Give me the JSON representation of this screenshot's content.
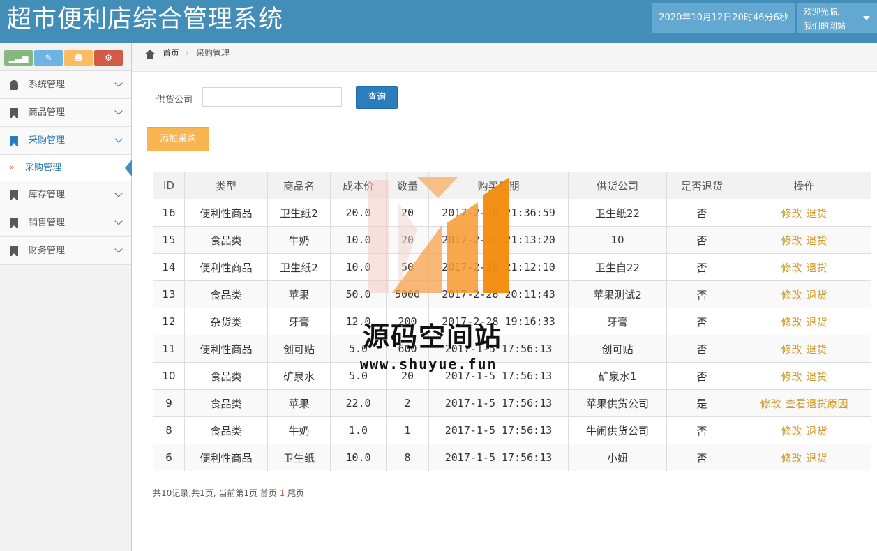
{
  "header": {
    "title": "超市便利店综合管理系统",
    "datetime": "2020年10月12日20时46分6秒",
    "welcome_line1": "欢迎光临,",
    "welcome_line2": "我们的网站"
  },
  "shortcuts": [
    {
      "icon": "signal-icon",
      "glyph": "▁▃▅",
      "color": "#87b87f"
    },
    {
      "icon": "pencil-icon",
      "glyph": "✎",
      "color": "#6fb3e0"
    },
    {
      "icon": "users-icon",
      "glyph": "☻",
      "color": "#fbbc64"
    },
    {
      "icon": "cogs-icon",
      "glyph": "⚙",
      "color": "#d15b47"
    }
  ],
  "sidebar": {
    "items": [
      {
        "label": "系统管理"
      },
      {
        "label": "商品管理"
      },
      {
        "label": "采购管理"
      },
      {
        "label": "库存管理"
      },
      {
        "label": "销售管理"
      },
      {
        "label": "财务管理"
      }
    ],
    "submenu": {
      "arrow": "»",
      "label": "采购管理"
    }
  },
  "breadcrumb": {
    "home": "首页",
    "sep": "›",
    "current": "采购管理"
  },
  "search": {
    "label": "供货公司",
    "value": "",
    "button": "查询"
  },
  "toolbar": {
    "add_label": "添加采购"
  },
  "table": {
    "headers": [
      "ID",
      "类型",
      "商品名",
      "成本价",
      "数量",
      "购买日期",
      "供货公司",
      "是否退货",
      "操作"
    ],
    "rows": [
      {
        "id": "16",
        "type": "便利性商品",
        "name": "卫生纸2",
        "cost": "20.0",
        "qty": "20",
        "date": "2017-2-28 21:36:59",
        "supplier": "卫生纸22",
        "returned": "否",
        "op1": "修改",
        "op2": "退货"
      },
      {
        "id": "15",
        "type": "食品类",
        "name": "牛奶",
        "cost": "10.0",
        "qty": "20",
        "date": "2017-2-28 21:13:20",
        "supplier": "10",
        "returned": "否",
        "op1": "修改",
        "op2": "退货"
      },
      {
        "id": "14",
        "type": "便利性商品",
        "name": "卫生纸2",
        "cost": "10.0",
        "qty": "50",
        "date": "2017-2-28 21:12:10",
        "supplier": "卫生自22",
        "returned": "否",
        "op1": "修改",
        "op2": "退货"
      },
      {
        "id": "13",
        "type": "食品类",
        "name": "苹果",
        "cost": "50.0",
        "qty": "5000",
        "date": "2017-2-28 20:11:43",
        "supplier": "苹果测试2",
        "returned": "否",
        "op1": "修改",
        "op2": "退货"
      },
      {
        "id": "12",
        "type": "杂货类",
        "name": "牙膏",
        "cost": "12.0",
        "qty": "200",
        "date": "2017-2-28 19:16:33",
        "supplier": "牙膏",
        "returned": "否",
        "op1": "修改",
        "op2": "退货"
      },
      {
        "id": "11",
        "type": "便利性商品",
        "name": "创可贴",
        "cost": "5.0",
        "qty": "600",
        "date": "2017-1-5 17:56:13",
        "supplier": "创可贴",
        "returned": "否",
        "op1": "修改",
        "op2": "退货"
      },
      {
        "id": "10",
        "type": "食品类",
        "name": "矿泉水",
        "cost": "5.0",
        "qty": "20",
        "date": "2017-1-5 17:56:13",
        "supplier": "矿泉水1",
        "returned": "否",
        "op1": "修改",
        "op2": "退货"
      },
      {
        "id": "9",
        "type": "食品类",
        "name": "苹果",
        "cost": "22.0",
        "qty": "2",
        "date": "2017-1-5 17:56:13",
        "supplier": "苹果供货公司",
        "returned": "是",
        "op1": "修改",
        "op2": "查看退货原因"
      },
      {
        "id": "8",
        "type": "食品类",
        "name": "牛奶",
        "cost": "1.0",
        "qty": "1",
        "date": "2017-1-5 17:56:13",
        "supplier": "牛闹供货公司",
        "returned": "否",
        "op1": "修改",
        "op2": "退货"
      },
      {
        "id": "6",
        "type": "便利性商品",
        "name": "卫生纸",
        "cost": "10.0",
        "qty": "8",
        "date": "2017-1-5 17:56:13",
        "supplier": "小妞",
        "returned": "否",
        "op1": "修改",
        "op2": "退货"
      }
    ]
  },
  "pager": {
    "prefix": "共10记录,共1页, 当前第1页 首页",
    "current": "1",
    "suffix": "尾页"
  },
  "watermark": {
    "text": "源码空间站",
    "url": "www.shuyue.fun"
  },
  "colors": {
    "header": "#438eb9",
    "primary": "#2b7dbc",
    "warning": "#f8b550",
    "link": "#d39b2a"
  }
}
